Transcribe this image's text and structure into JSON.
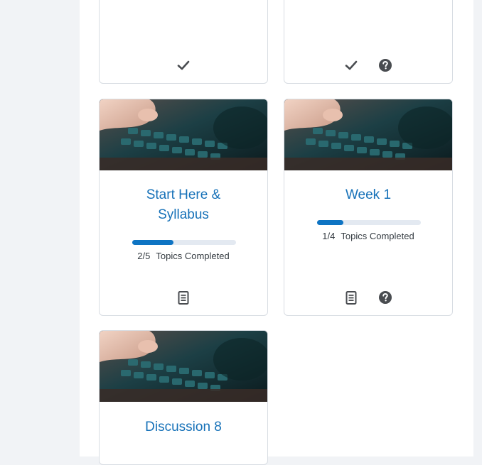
{
  "colors": {
    "page_bg": "#f1f3f6",
    "panel_bg": "#ffffff",
    "card_border": "#d8dde3",
    "title_link": "#1671b8",
    "progress_fill": "#0e74c3",
    "progress_track": "#e3e9f1",
    "icon": "#494c50"
  },
  "cards": [
    {
      "title": "",
      "icons": [
        "checkmark-icon"
      ]
    },
    {
      "title": "",
      "icons": [
        "checkmark-icon",
        "help-circle-icon"
      ]
    },
    {
      "title": "Start Here & Syllabus",
      "progress": {
        "completed": 2,
        "total": 5,
        "fraction": 0.4,
        "count": "2/5",
        "label": "Topics Completed"
      },
      "icons": [
        "document-icon"
      ]
    },
    {
      "title": "Week 1",
      "progress": {
        "completed": 1,
        "total": 4,
        "fraction": 0.25,
        "count": "1/4",
        "label": "Topics Completed"
      },
      "icons": [
        "document-icon",
        "help-circle-icon"
      ]
    },
    {
      "title": "Discussion 8",
      "icons": []
    }
  ]
}
